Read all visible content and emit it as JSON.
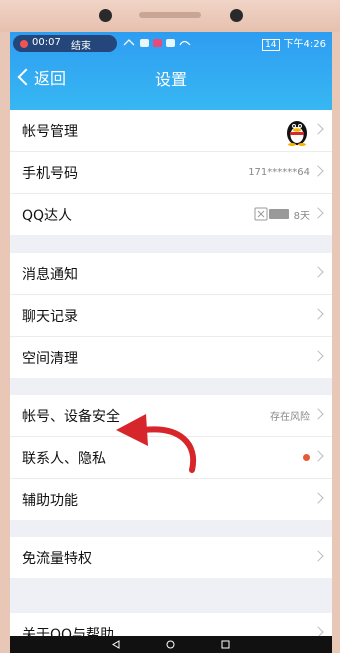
{
  "status_bar": {
    "call_time": "00:07",
    "call_end": "结束",
    "network": "下午4:26",
    "battery_level": "14"
  },
  "nav": {
    "back_label": "返回",
    "title": "设置"
  },
  "groups": [
    {
      "rows": [
        {
          "label": "帐号管理",
          "right": ""
        },
        {
          "label": "手机号码",
          "right": "171******64"
        },
        {
          "label": "QQ达人",
          "right": "8天"
        }
      ]
    },
    {
      "rows": [
        {
          "label": "消息通知",
          "right": ""
        },
        {
          "label": "聊天记录",
          "right": ""
        },
        {
          "label": "空间清理",
          "right": ""
        }
      ]
    },
    {
      "rows": [
        {
          "label": "帐号、设备安全",
          "right": "存在风险"
        },
        {
          "label": "联系人、隐私",
          "right": ""
        },
        {
          "label": "辅助功能",
          "right": ""
        }
      ]
    },
    {
      "rows": [
        {
          "label": "免流量特权",
          "right": ""
        }
      ]
    },
    {
      "rows": [
        {
          "label": "关于QQ与帮助",
          "right": ""
        }
      ]
    }
  ],
  "colors": {
    "header_top": "#2e9df1",
    "header_bottom": "#38b9f3",
    "alert_dot": "#e65a35",
    "annotation_arrow": "#d6262b"
  }
}
